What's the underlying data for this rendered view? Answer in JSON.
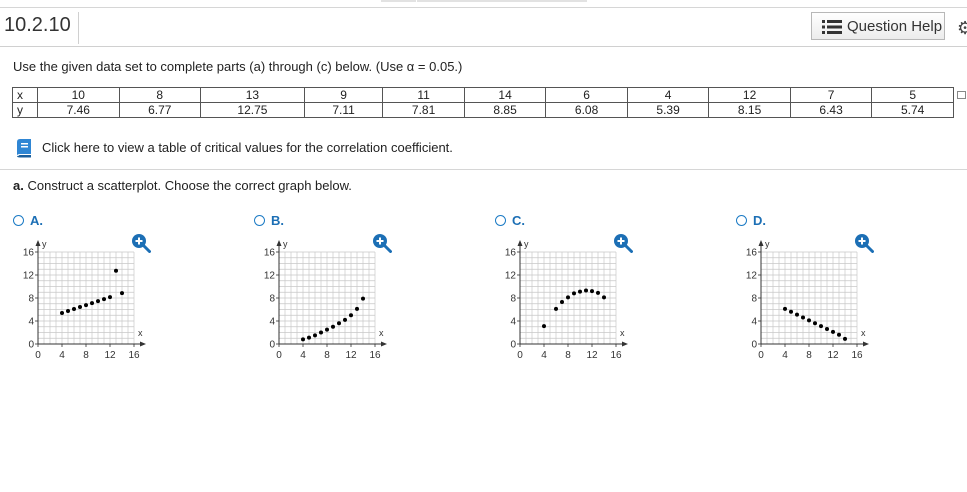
{
  "header": {
    "question_id": "10.2.10",
    "help_label": "Question Help"
  },
  "instructions": "Use the given data set to complete parts (a) through (c) below. (Use α = 0.05.)",
  "table": {
    "row_x_label": "x",
    "row_y_label": "y",
    "x": [
      "10",
      "8",
      "13",
      "9",
      "11",
      "14",
      "6",
      "4",
      "12",
      "7",
      "5"
    ],
    "y": [
      "7.46",
      "6.77",
      "12.75",
      "7.11",
      "7.81",
      "8.85",
      "6.08",
      "5.39",
      "8.15",
      "6.43",
      "5.74"
    ]
  },
  "critical_values_link": "Click here to view a table of critical values for the correlation coefficient.",
  "part_a": {
    "label": "a.",
    "text": "Construct a scatterplot. Choose the correct graph below."
  },
  "options": [
    {
      "label": "A.",
      "points": [
        [
          4,
          5.39
        ],
        [
          5,
          5.74
        ],
        [
          6,
          6.08
        ],
        [
          7,
          6.43
        ],
        [
          8,
          6.77
        ],
        [
          9,
          7.11
        ],
        [
          10,
          7.46
        ],
        [
          11,
          7.81
        ],
        [
          12,
          8.15
        ],
        [
          13,
          12.75
        ],
        [
          14,
          8.85
        ]
      ]
    },
    {
      "label": "B.",
      "points": [
        [
          4,
          0.8
        ],
        [
          5,
          1.1
        ],
        [
          6,
          1.5
        ],
        [
          7,
          2.0
        ],
        [
          8,
          2.5
        ],
        [
          9,
          3.0
        ],
        [
          10,
          3.6
        ],
        [
          11,
          4.2
        ],
        [
          12,
          5.0
        ],
        [
          13,
          6.1
        ],
        [
          14,
          7.9
        ]
      ]
    },
    {
      "label": "C.",
      "points": [
        [
          4,
          3.1
        ],
        [
          6,
          6.1
        ],
        [
          7,
          7.3
        ],
        [
          8,
          8.1
        ],
        [
          9,
          8.8
        ],
        [
          10,
          9.1
        ],
        [
          11,
          9.3
        ],
        [
          12,
          9.2
        ],
        [
          13,
          8.9
        ],
        [
          14,
          8.1
        ]
      ]
    },
    {
      "label": "D.",
      "points": [
        [
          4,
          6.1
        ],
        [
          5,
          5.6
        ],
        [
          6,
          5.1
        ],
        [
          7,
          4.6
        ],
        [
          8,
          4.1
        ],
        [
          9,
          3.6
        ],
        [
          10,
          3.1
        ],
        [
          11,
          2.6
        ],
        [
          12,
          2.1
        ],
        [
          13,
          1.6
        ],
        [
          14,
          0.9
        ]
      ]
    }
  ],
  "graph_axes": {
    "x_label": "x",
    "y_label": "y",
    "x_ticks": [
      "0",
      "4",
      "8",
      "12",
      "16"
    ],
    "y_ticks": [
      "0",
      "4",
      "8",
      "12",
      "16"
    ],
    "xlim": [
      0,
      16
    ],
    "ylim": [
      0,
      16
    ],
    "grid": true
  },
  "colors": {
    "accent": "#1c6fb5",
    "grid": "#c8c8c8",
    "point": "#000000"
  }
}
